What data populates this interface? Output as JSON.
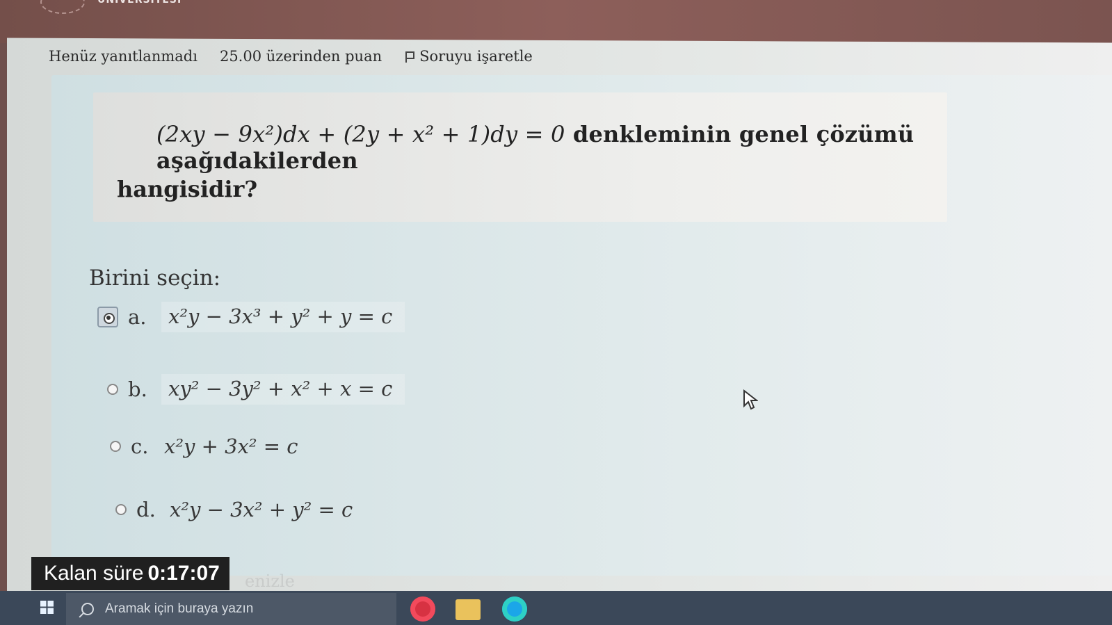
{
  "header": {
    "brand_text": "UNIVERSITESI"
  },
  "question_meta": {
    "status": "Henüz yanıtlanmadı",
    "score": "25.00 üzerinden puan",
    "flag": "Soruyu işaretle"
  },
  "question": {
    "equation": "(2xy − 9x²)dx + (2y + x² + 1)dy = 0",
    "text_line1_suffix": "denkleminin genel çözümü aşağıdakilerden",
    "text_line2": "hangisidir?"
  },
  "answer": {
    "prompt": "Birini seçin:",
    "selected": "a",
    "options": [
      {
        "letter": "a.",
        "expression": "x²y − 3x³ + y² + y = c"
      },
      {
        "letter": "b.",
        "expression": "xy² − 3y² + x² + x = c"
      },
      {
        "letter": "c.",
        "expression": "x²y + 3x² = c"
      },
      {
        "letter": "d.",
        "expression": "x²y − 3x² + y² = c"
      }
    ]
  },
  "timer": {
    "label": "Kalan süre",
    "value": "0:17:07"
  },
  "taskbar": {
    "search_placeholder": "Aramak için buraya yazın",
    "apps": [
      "opera-icon",
      "folder-icon",
      "edge-icon"
    ]
  },
  "colors": {
    "top_bar": "#8d5f5a",
    "question_area": "#e2ebec",
    "timer_bg": "#202020",
    "taskbar_bg": "#3b4859"
  },
  "faded_text": "enizle"
}
